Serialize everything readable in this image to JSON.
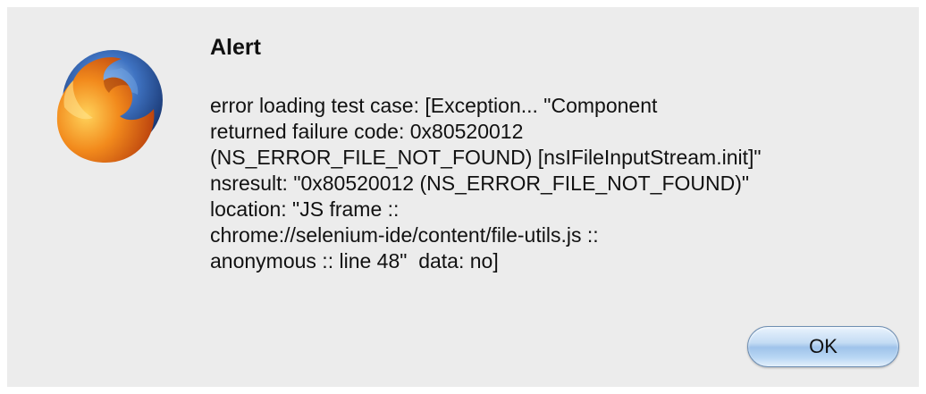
{
  "dialog": {
    "title": "Alert",
    "icon": "firefox-logo-icon",
    "message_lines": [
      "error loading test case: [Exception... \"Component",
      "returned failure code: 0x80520012",
      "(NS_ERROR_FILE_NOT_FOUND) [nsIFileInputStream.init]\"",
      "nsresult: \"0x80520012 (NS_ERROR_FILE_NOT_FOUND)\"",
      "location: \"JS frame ::",
      "chrome://selenium-ide/content/file-utils.js ::",
      "anonymous :: line 48\"  data: no]"
    ],
    "ok_label": "OK"
  },
  "colors": {
    "dialog_background": "#ececec",
    "button_accent": "#9fc3ea"
  }
}
